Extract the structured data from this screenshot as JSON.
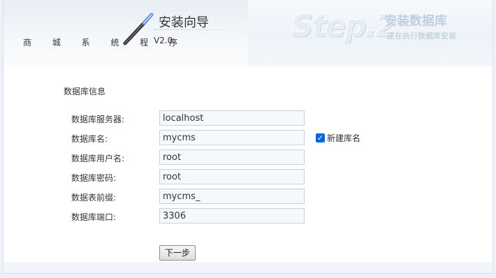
{
  "header": {
    "system_name": "商 城 系 统 程 序",
    "wizard_title": "安装向导",
    "version": "V2.0",
    "step_number": "Step.2",
    "step_title": "安装数据库",
    "step_subtitle": "正在执行数据库安装"
  },
  "form": {
    "section_title": "数据库信息",
    "fields": [
      {
        "label": "数据库服务器:",
        "value": "localhost"
      },
      {
        "label": "数据库名:",
        "value": "mycms"
      },
      {
        "label": "数据库用户名:",
        "value": "root"
      },
      {
        "label": "数据库密码:",
        "value": "root"
      },
      {
        "label": "数据表前缀:",
        "value": "mycms_"
      },
      {
        "label": "数据库端口:",
        "value": "3306"
      }
    ],
    "create_db": {
      "label": "新建库名",
      "checked": true
    },
    "next_button": "下一步"
  },
  "colors": {
    "checkbox_accent": "#0a66d8",
    "input_border": "#c7d0dc",
    "step_title": "#c2cfe0"
  }
}
